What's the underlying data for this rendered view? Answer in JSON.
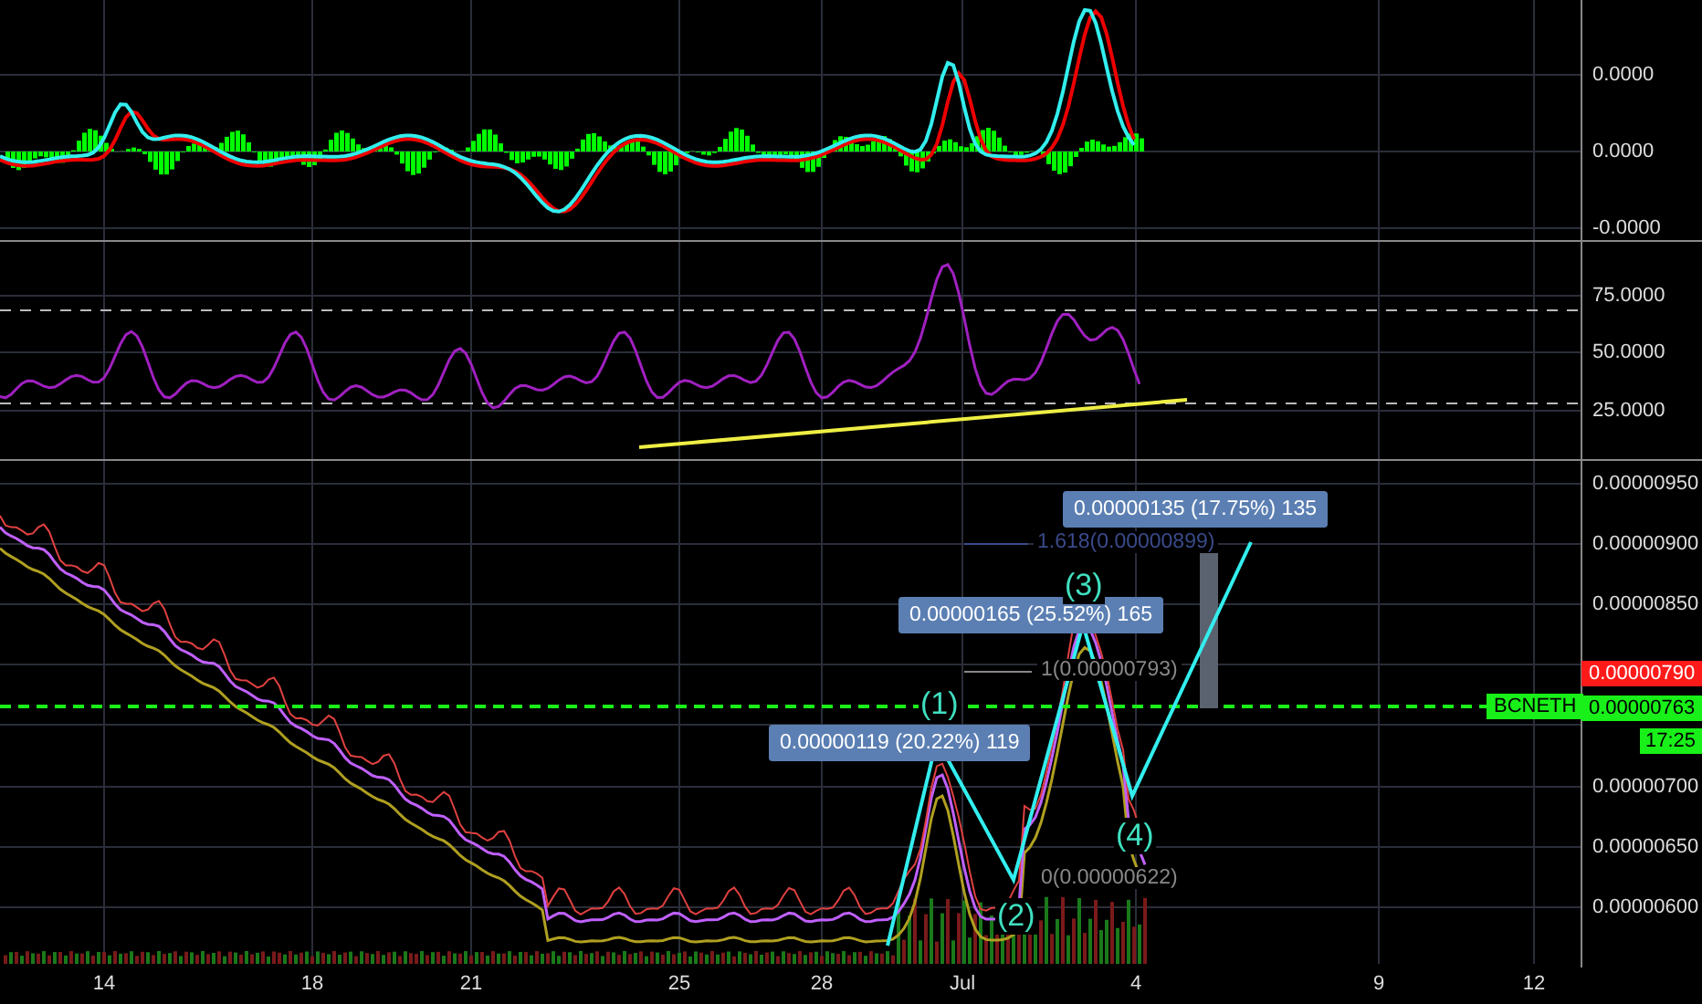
{
  "oscillator_pane": {
    "axis_labels": [
      "0.0000",
      "0.0000",
      "-0.0000"
    ]
  },
  "rsi_pane": {
    "axis_labels": [
      "75.0000",
      "50.0000",
      "25.0000"
    ]
  },
  "price_pane": {
    "axis_labels": [
      "0.00000950",
      "0.00000900",
      "0.00000850",
      "0.00000700",
      "0.00000650",
      "0.00000600"
    ],
    "price_badges": [
      {
        "kind": "previous",
        "text": "0.00000790"
      },
      {
        "kind": "current",
        "text": "0.00000763"
      }
    ],
    "symbol_label": "BCNETH",
    "countdown": "17:25",
    "measure_labels": [
      "0.00000135 (17.75%) 135",
      "0.00000165 (25.52%) 165",
      "0.00000119 (20.22%) 119"
    ],
    "fib_labels": [
      "1.618(0.00000899)",
      "1(0.00000793)",
      "0(0.00000622)"
    ],
    "wave_labels": [
      "(1)",
      "(2)",
      "(3)",
      "(4)"
    ]
  },
  "x_axis": {
    "labels": [
      "14",
      "18",
      "21",
      "25",
      "28",
      "Jul",
      "4",
      "9",
      "12"
    ]
  }
}
